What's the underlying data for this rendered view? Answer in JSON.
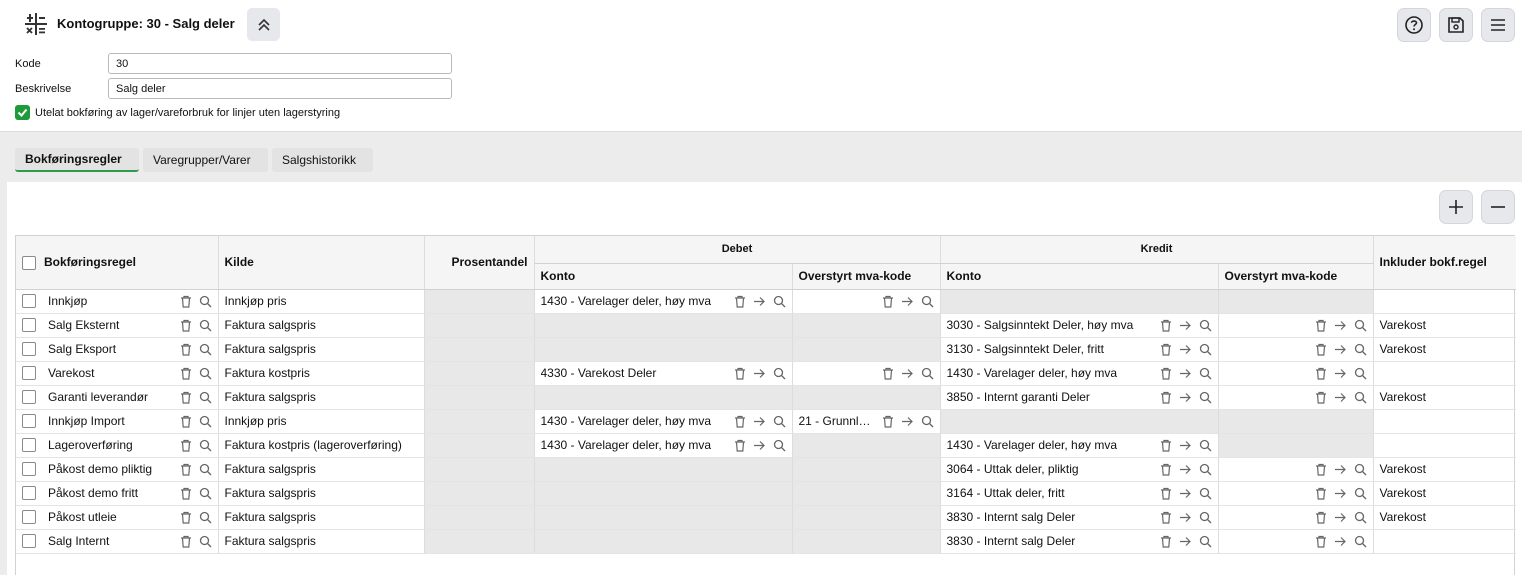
{
  "header": {
    "title": "Kontogruppe: 30 - Salg deler"
  },
  "form": {
    "kode_label": "Kode",
    "kode_value": "30",
    "beskrivelse_label": "Beskrivelse",
    "beskrivelse_value": "Salg deler",
    "checkbox_label": "Utelat bokføring av lager/vareforbruk for linjer uten lagerstyring"
  },
  "tabs": [
    {
      "label": "Bokføringsregler"
    },
    {
      "label": "Varegrupper/Varer"
    },
    {
      "label": "Salgshistorikk"
    }
  ],
  "table": {
    "headers": {
      "rule": "Bokføringsregel",
      "source": "Kilde",
      "percent": "Prosentandel",
      "debet": "Debet",
      "kredit": "Kredit",
      "konto": "Konto",
      "mva": "Overstyrt mva-kode",
      "include": "Inkluder bokf.regel"
    },
    "rows": [
      {
        "rule": "Innkjøp",
        "source": "Innkjøp pris",
        "debet_konto": "1430 - Varelager deler, høy mva",
        "debet_mva": "",
        "kredit_konto": "",
        "kredit_mva": "",
        "include": ""
      },
      {
        "rule": "Salg Eksternt",
        "source": "Faktura salgspris",
        "debet_konto": "",
        "debet_mva": "",
        "kredit_konto": "3030 - Salgsinntekt Deler, høy mva",
        "kredit_mva": "",
        "include": "Varekost"
      },
      {
        "rule": "Salg Eksport",
        "source": "Faktura salgspris",
        "debet_konto": "",
        "debet_mva": "",
        "kredit_konto": "3130 - Salgsinntekt Deler, fritt",
        "kredit_mva": "",
        "include": "Varekost"
      },
      {
        "rule": "Varekost",
        "source": "Faktura kostpris",
        "debet_konto": "4330 - Varekost Deler",
        "debet_mva": "",
        "kredit_konto": "1430 - Varelager deler, høy mva",
        "kredit_mva": "",
        "include": ""
      },
      {
        "rule": "Garanti leverandør",
        "source": "Faktura salgspris",
        "debet_konto": "",
        "debet_mva": "",
        "kredit_konto": "3850 - Internt garanti Deler",
        "kredit_mva": "",
        "include": "Varekost"
      },
      {
        "rule": "Innkjøp Import",
        "source": "Innkjøp pris",
        "debet_konto": "1430 - Varelager deler, høy mva",
        "debet_mva": "21 - Grunnla…",
        "kredit_konto": "",
        "kredit_mva": "",
        "include": ""
      },
      {
        "rule": "Lageroverføring",
        "source": "Faktura kostpris (lageroverføring)",
        "debet_konto": "1430 - Varelager deler, høy mva",
        "debet_mva": "",
        "kredit_konto": "1430 - Varelager deler, høy mva",
        "kredit_mva": "",
        "include": ""
      },
      {
        "rule": "Påkost demo pliktig",
        "source": "Faktura salgspris",
        "debet_konto": "",
        "debet_mva": "",
        "kredit_konto": "3064 - Uttak deler, pliktig",
        "kredit_mva": "",
        "include": "Varekost"
      },
      {
        "rule": "Påkost demo fritt",
        "source": "Faktura salgspris",
        "debet_konto": "",
        "debet_mva": "",
        "kredit_konto": "3164 - Uttak deler, fritt",
        "kredit_mva": "",
        "include": "Varekost"
      },
      {
        "rule": "Påkost utleie",
        "source": "Faktura salgspris",
        "debet_konto": "",
        "debet_mva": "",
        "kredit_konto": "3830 - Internt salg Deler",
        "kredit_mva": "",
        "include": "Varekost"
      },
      {
        "rule": "Salg Internt",
        "source": "Faktura salgspris",
        "debet_konto": "",
        "debet_mva": "",
        "kredit_konto": "3830 - Internt salg Deler",
        "kredit_mva": "",
        "include": ""
      }
    ]
  },
  "colors": {
    "accent": "#1e9a3a",
    "tab_underline": "#2f9b4d",
    "disabled_cell": "#e8e8e8"
  }
}
